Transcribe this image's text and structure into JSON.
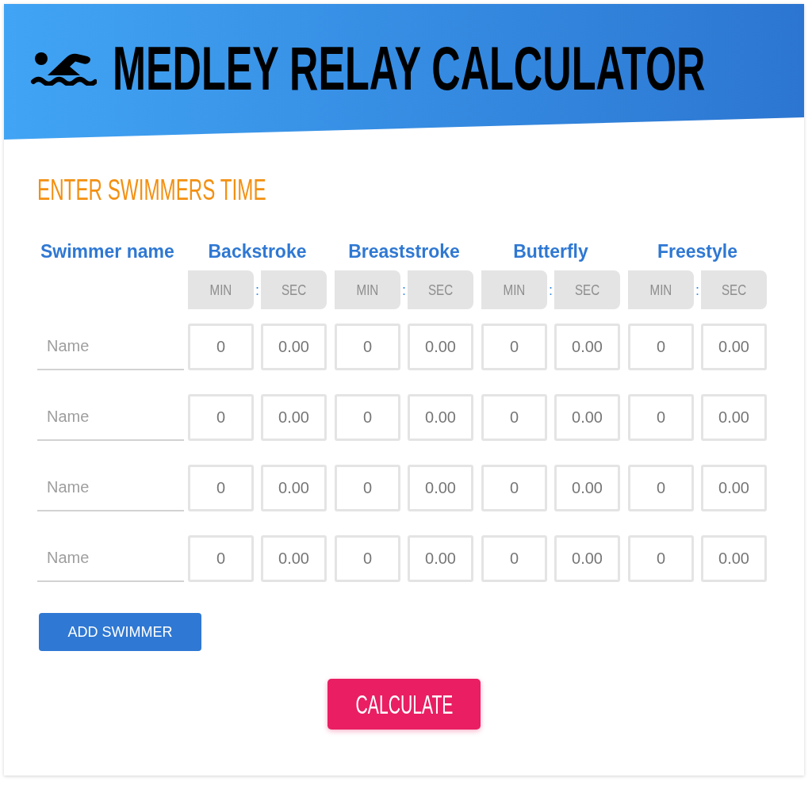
{
  "header": {
    "title": "MEDLEY RELAY CALCULATOR"
  },
  "section_title": "ENTER SWIMMERS TIME",
  "table": {
    "name_heading": "Swimmer name",
    "strokes": [
      {
        "name": "Backstroke",
        "min_label": "MIN",
        "separator": ":",
        "sec_label": "SEC"
      },
      {
        "name": "Breaststroke",
        "min_label": "MIN",
        "separator": ":",
        "sec_label": "SEC"
      },
      {
        "name": "Butterfly",
        "min_label": "MIN",
        "separator": ":",
        "sec_label": "SEC"
      },
      {
        "name": "Freestyle",
        "min_label": "MIN",
        "separator": ":",
        "sec_label": "SEC"
      }
    ],
    "rows": [
      {
        "name": {
          "placeholder": "Name"
        },
        "times": [
          {
            "min": "0",
            "sec": "0.00"
          },
          {
            "min": "0",
            "sec": "0.00"
          },
          {
            "min": "0",
            "sec": "0.00"
          },
          {
            "min": "0",
            "sec": "0.00"
          }
        ]
      },
      {
        "name": {
          "placeholder": "Name"
        },
        "times": [
          {
            "min": "0",
            "sec": "0.00"
          },
          {
            "min": "0",
            "sec": "0.00"
          },
          {
            "min": "0",
            "sec": "0.00"
          },
          {
            "min": "0",
            "sec": "0.00"
          }
        ]
      },
      {
        "name": {
          "placeholder": "Name"
        },
        "times": [
          {
            "min": "0",
            "sec": "0.00"
          },
          {
            "min": "0",
            "sec": "0.00"
          },
          {
            "min": "0",
            "sec": "0.00"
          },
          {
            "min": "0",
            "sec": "0.00"
          }
        ]
      },
      {
        "name": {
          "placeholder": "Name"
        },
        "times": [
          {
            "min": "0",
            "sec": "0.00"
          },
          {
            "min": "0",
            "sec": "0.00"
          },
          {
            "min": "0",
            "sec": "0.00"
          },
          {
            "min": "0",
            "sec": "0.00"
          }
        ]
      }
    ]
  },
  "add_button": "ADD SWIMMER",
  "calculate_button": "CALCULATE"
}
